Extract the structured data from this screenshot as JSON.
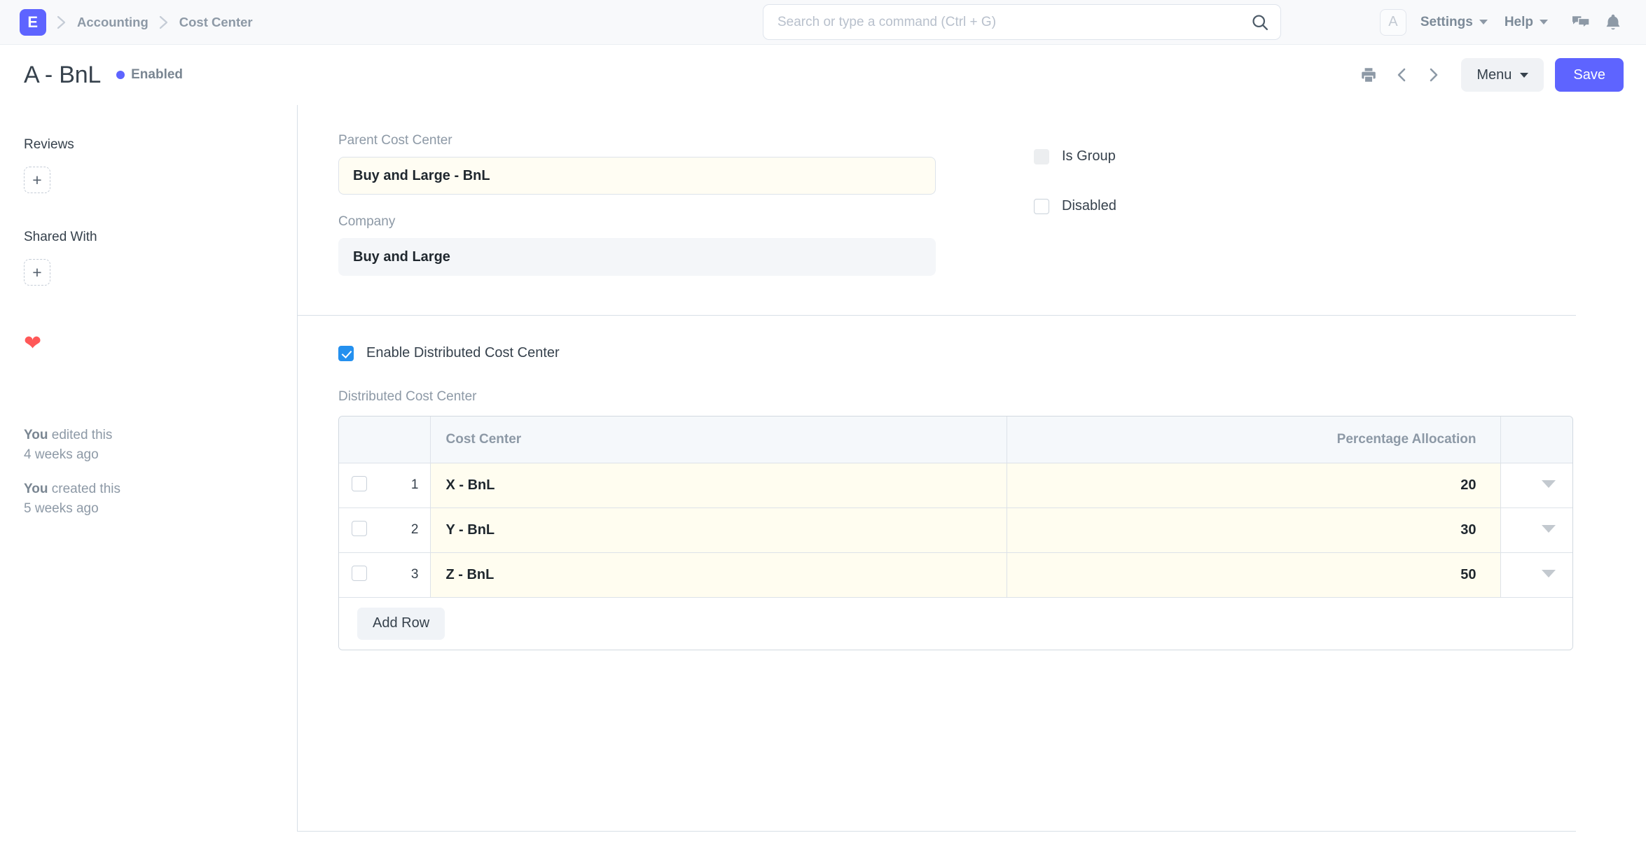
{
  "navbar": {
    "logo_letter": "E",
    "breadcrumbs": [
      "Accounting",
      "Cost Center"
    ],
    "search": {
      "placeholder": "Search or type a command (Ctrl + G)",
      "value": "",
      "icon": "search-icon"
    },
    "avatar_letter": "A",
    "menus": [
      {
        "label": "Settings"
      },
      {
        "label": "Help"
      }
    ],
    "icons": [
      "comment-icon",
      "bell-icon"
    ]
  },
  "page_head": {
    "title": "A - BnL",
    "status": "Enabled",
    "status_color": "#5e64ff",
    "print_icon": "print-icon",
    "prev_icon": "chevron-left-icon",
    "next_icon": "chevron-right-icon",
    "menu_label": "Menu",
    "save_label": "Save",
    "save_color": "#5e64ff"
  },
  "sidebar": {
    "reviews_title": "Reviews",
    "reviews_add": "+",
    "shared_with_title": "Shared With",
    "shared_with_add": "+",
    "like_icon": "heart-icon",
    "like_color": "#ff5858",
    "activity": [
      {
        "who": "You",
        "what": " edited this",
        "when": "4 weeks ago"
      },
      {
        "who": "You",
        "what": " created this",
        "when": "5 weeks ago"
      }
    ]
  },
  "form": {
    "parent_cost_center": {
      "label": "Parent Cost Center",
      "value": "Buy and Large - BnL",
      "state": "modified"
    },
    "company": {
      "label": "Company",
      "value": "Buy and Large",
      "state": "readonly"
    },
    "is_group": {
      "label": "Is Group",
      "checked": false,
      "disabled": true
    },
    "disabled": {
      "label": "Disabled",
      "checked": false,
      "disabled": false
    },
    "enable_distributed": {
      "label": "Enable Distributed Cost Center",
      "checked": true,
      "accent": "#2490ef"
    }
  },
  "grid": {
    "label": "Distributed Cost Center",
    "columns": [
      "",
      "",
      "Cost Center",
      "Percentage Allocation",
      ""
    ],
    "rows": [
      {
        "idx": "1",
        "cost_center": "X - BnL",
        "percentage": "20"
      },
      {
        "idx": "2",
        "cost_center": "Y - BnL",
        "percentage": "30"
      },
      {
        "idx": "3",
        "cost_center": "Z - BnL",
        "percentage": "50"
      }
    ],
    "add_row_label": "Add Row"
  }
}
